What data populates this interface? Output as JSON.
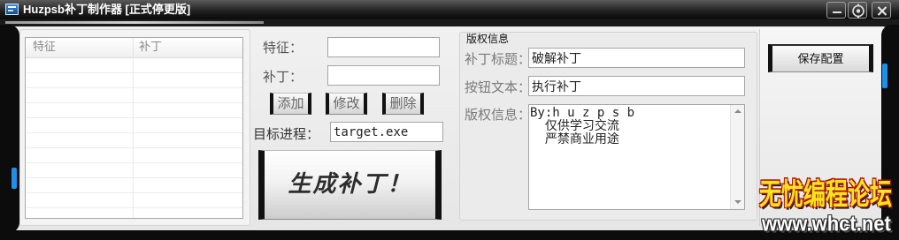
{
  "window": {
    "title": "Huzpsb补丁制作器 [正式停更版]",
    "icon": "app-window-icon"
  },
  "title_buttons": {
    "minimize_icon": "minimize-icon",
    "settings_icon": "settings-icon",
    "close_icon": "close-icon"
  },
  "patch_list": {
    "columns": [
      "特征",
      "补丁"
    ],
    "rows": []
  },
  "editor": {
    "feature_label": "特征：",
    "feature_value": "",
    "patch_label": "补丁：",
    "patch_value": "",
    "add": "添加",
    "modify": "修改",
    "delete": "删除",
    "target_label": "目标进程：",
    "target_value": "target.exe",
    "generate": "生成补丁！"
  },
  "copyright": {
    "group_title": "版权信息",
    "title_label": "补丁标题：",
    "title_value": "破解补丁",
    "button_label": "按钮文本：",
    "button_value": "执行补丁",
    "info_label": "版权信息：",
    "info_value": "By:h u z p s b\n  仅供学习交流\n  严禁商业用途"
  },
  "save_button": "保存配置",
  "watermark": {
    "line1": "无忧编程论坛",
    "line2": "www.whct.net"
  },
  "colors": {
    "accent": "#1e90e6",
    "frame": "#121212",
    "client": "#ececec",
    "watermark_fill": "#f5e61c",
    "watermark_outline": "#b31010"
  }
}
